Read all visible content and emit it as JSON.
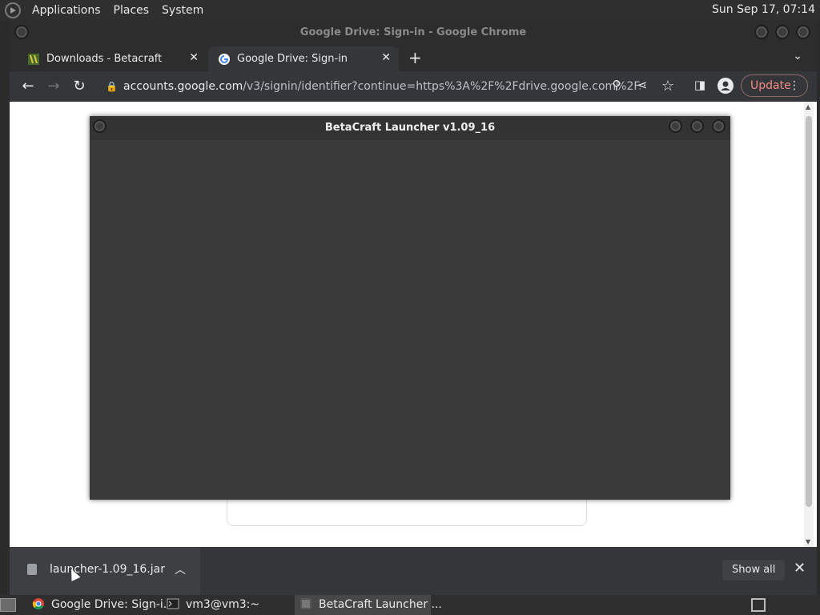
{
  "top_panel": {
    "menus": [
      "Applications",
      "Places",
      "System"
    ],
    "clock": "Sun Sep 17, 07:14"
  },
  "chrome": {
    "window_title": "Google Drive: Sign-in - Google Chrome",
    "tabs": [
      {
        "label": "Downloads - Betacraft",
        "icon": "betacraft-icon"
      },
      {
        "label": "Google Drive: Sign-in",
        "icon": "google-icon"
      }
    ],
    "address": {
      "host": "accounts.google.com",
      "path": "/v3/signin/identifier?continue=https%3A%2F%2Fdrive.google.com%2F..."
    },
    "update_label": "Update"
  },
  "download_shelf": {
    "file_name": "launcher-1.09_16.jar",
    "show_all_label": "Show all"
  },
  "betacraft": {
    "title": "BetaCraft Launcher v1.09_16"
  },
  "taskbar": {
    "items": [
      {
        "label": "Google Drive: Sign-i...",
        "icon": "chrome-icon"
      },
      {
        "label": "vm3@vm3:~",
        "icon": "terminal-icon"
      },
      {
        "label": "BetaCraft Launcher ...",
        "icon": "betacraft-icon"
      }
    ]
  },
  "colors": {
    "accent": "#f28b82",
    "panel": "#2f2f2f",
    "chrome_dark": "#35363a"
  }
}
